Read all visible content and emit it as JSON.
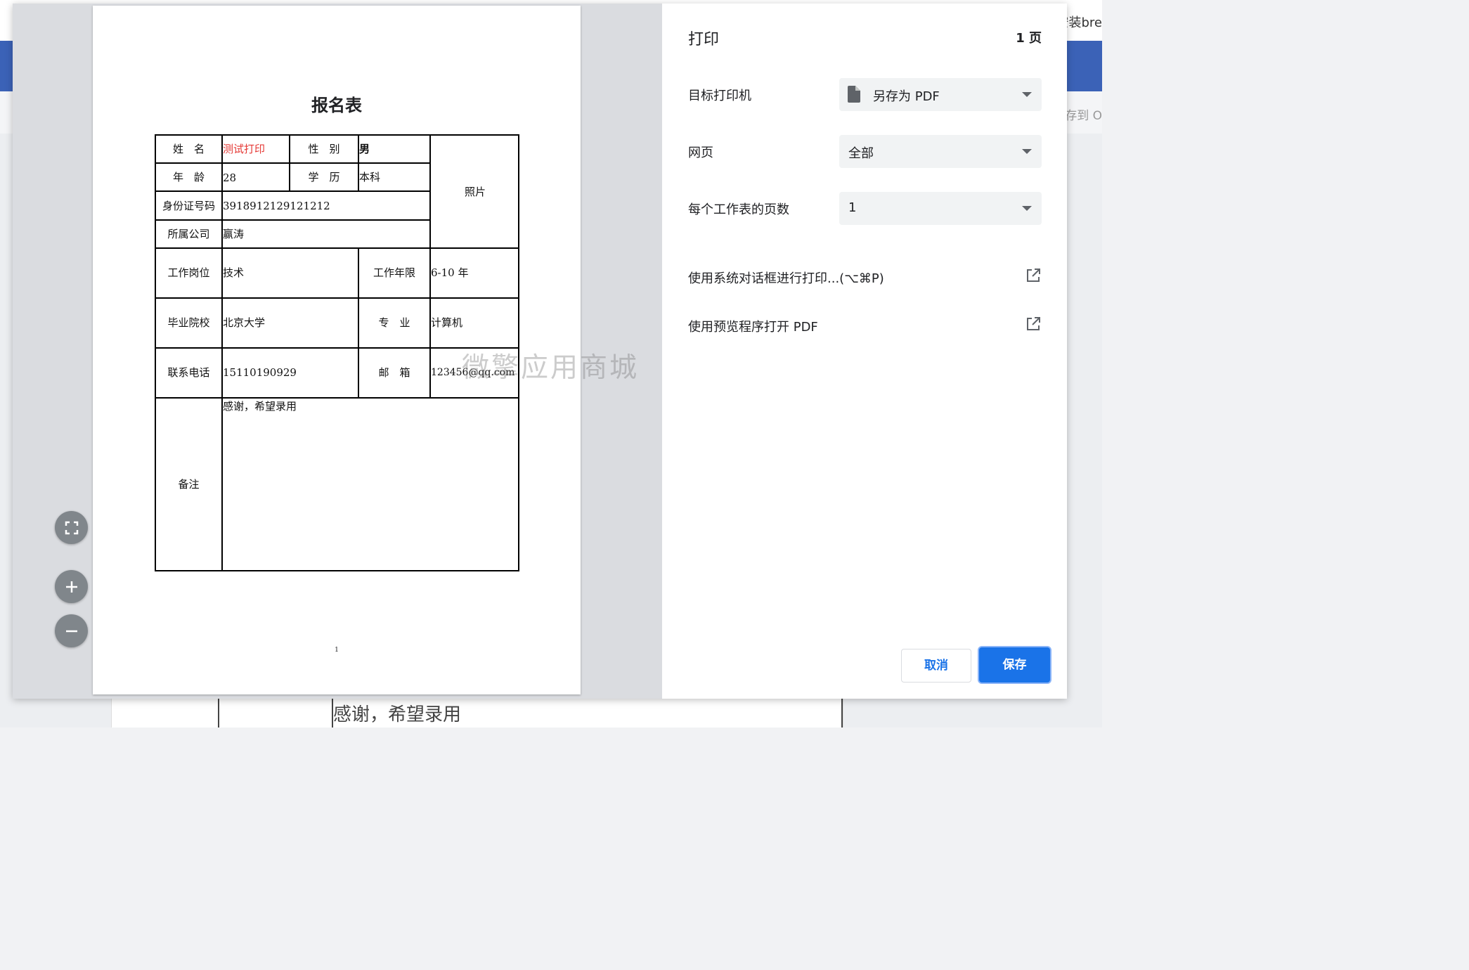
{
  "background": {
    "install_text": "安装bre",
    "save_text": "存到 O",
    "remark_text": "感谢，希望录用"
  },
  "preview": {
    "title": "报名表",
    "form": {
      "name_label": "姓　名",
      "name_value": "测试打印",
      "gender_label": "性　别",
      "gender_value": "男",
      "photo_label": "照片",
      "age_label": "年　龄",
      "age_value": "28",
      "education_label": "学　历",
      "education_value": "本科",
      "id_label": "身份证号码",
      "id_value": "3918912129121212",
      "company_label": "所属公司",
      "company_value": "赢涛",
      "position_label": "工作岗位",
      "position_value": "技术",
      "years_label": "工作年限",
      "years_value": "6-10 年",
      "school_label": "毕业院校",
      "school_value": "北京大学",
      "major_label": "专　业",
      "major_value": "计算机",
      "phone_label": "联系电话",
      "phone_value": "15110190929",
      "email_label": "邮　箱",
      "email_value": "123456@qq.com",
      "remarks_label": "备注",
      "remarks_value": "感谢，希望录用"
    },
    "page_number": "1",
    "watermark": "微擎应用商城"
  },
  "settings": {
    "title": "打印",
    "page_count": "1 页",
    "printer_label": "目标打印机",
    "printer_value": "另存为 PDF",
    "pages_label": "网页",
    "pages_value": "全部",
    "per_sheet_label": "每个工作表的页数",
    "per_sheet_value": "1",
    "system_dialog_link": "使用系统对话框进行打印...(⌥⌘P)",
    "open_preview_link": "使用预览程序打开 PDF",
    "cancel_label": "取消",
    "save_label": "保存"
  },
  "colors": {
    "accent": "#1a73e8",
    "header_blue": "#3b62b7",
    "name_red": "#e53935"
  }
}
